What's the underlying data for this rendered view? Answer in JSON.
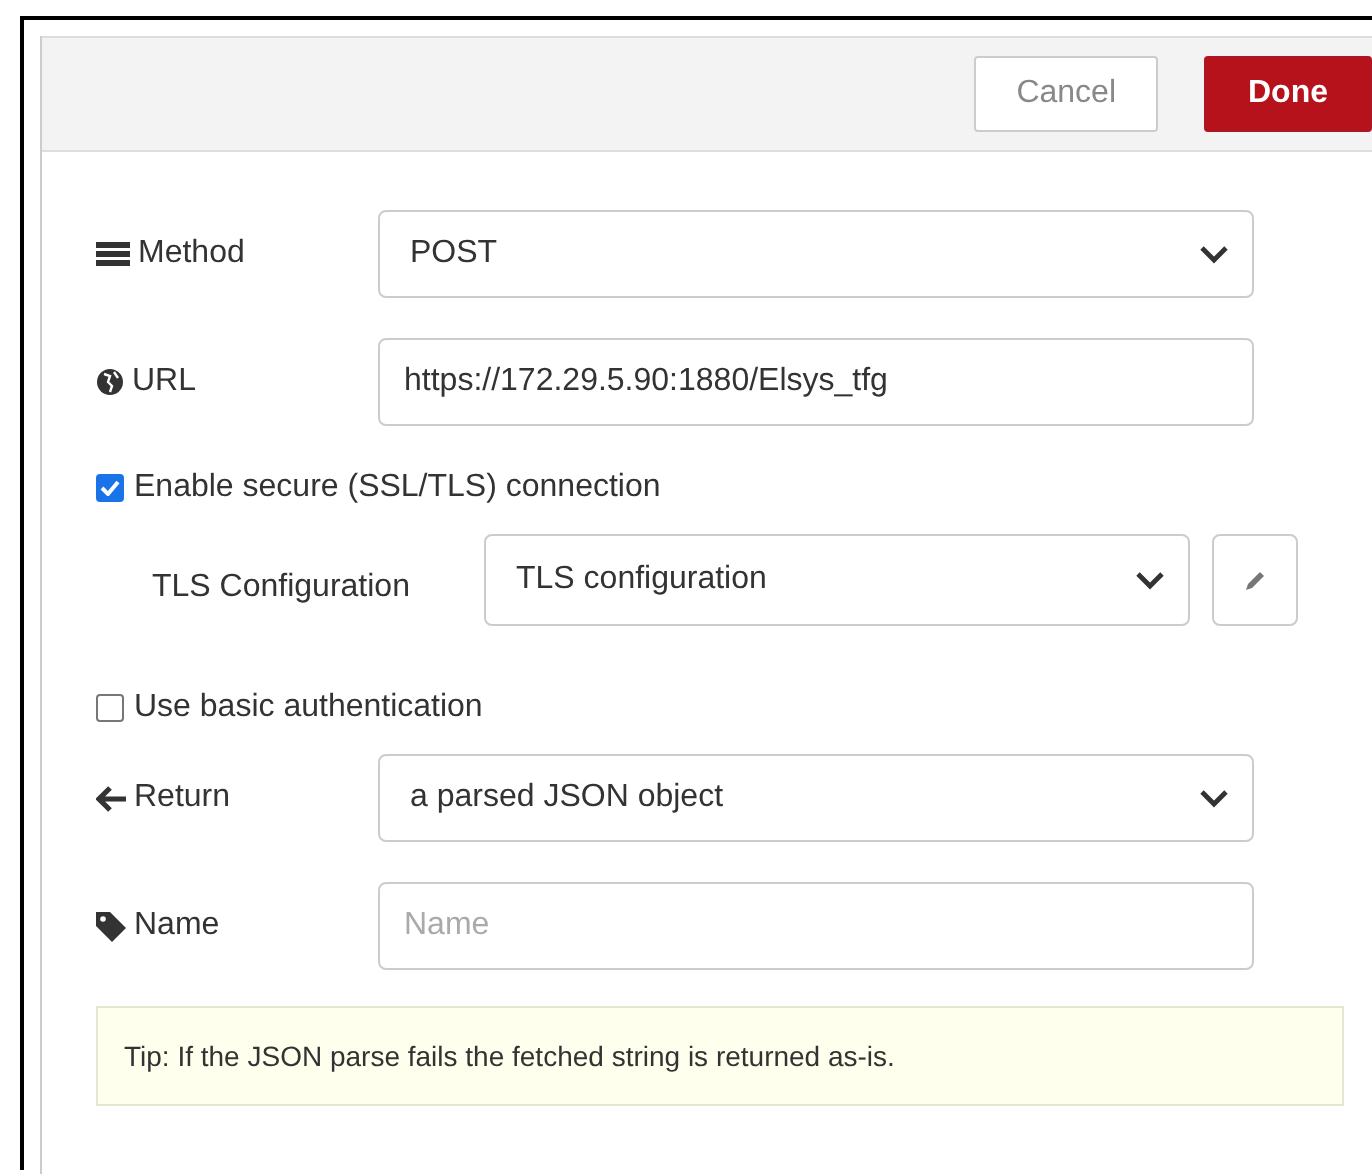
{
  "buttons": [
    {
      "label": "Cancel",
      "kind": "secondary"
    },
    {
      "label": "Done",
      "kind": "primary"
    }
  ],
  "rows": [
    {
      "kind": "select",
      "label": "Method",
      "value": "POST"
    },
    {
      "kind": "input",
      "label": "URL",
      "value": "https://172.29.5.90:1880/Elsys_tfg"
    },
    {
      "kind": "checkbox",
      "label": "Enable secure (SSL/TLS) connection",
      "checked": true
    },
    {
      "kind": "tls",
      "label": "TLS Configuration",
      "value": "TLS configuration"
    },
    {
      "kind": "checkbox",
      "label": "Use basic authentication",
      "checked": false
    },
    {
      "kind": "select",
      "label": "Return",
      "value": "a parsed JSON object"
    },
    {
      "kind": "input",
      "label": "Name",
      "placeholder": "Name"
    }
  ],
  "tip": "Tip: If the JSON parse fails the fetched string is returned as-is."
}
